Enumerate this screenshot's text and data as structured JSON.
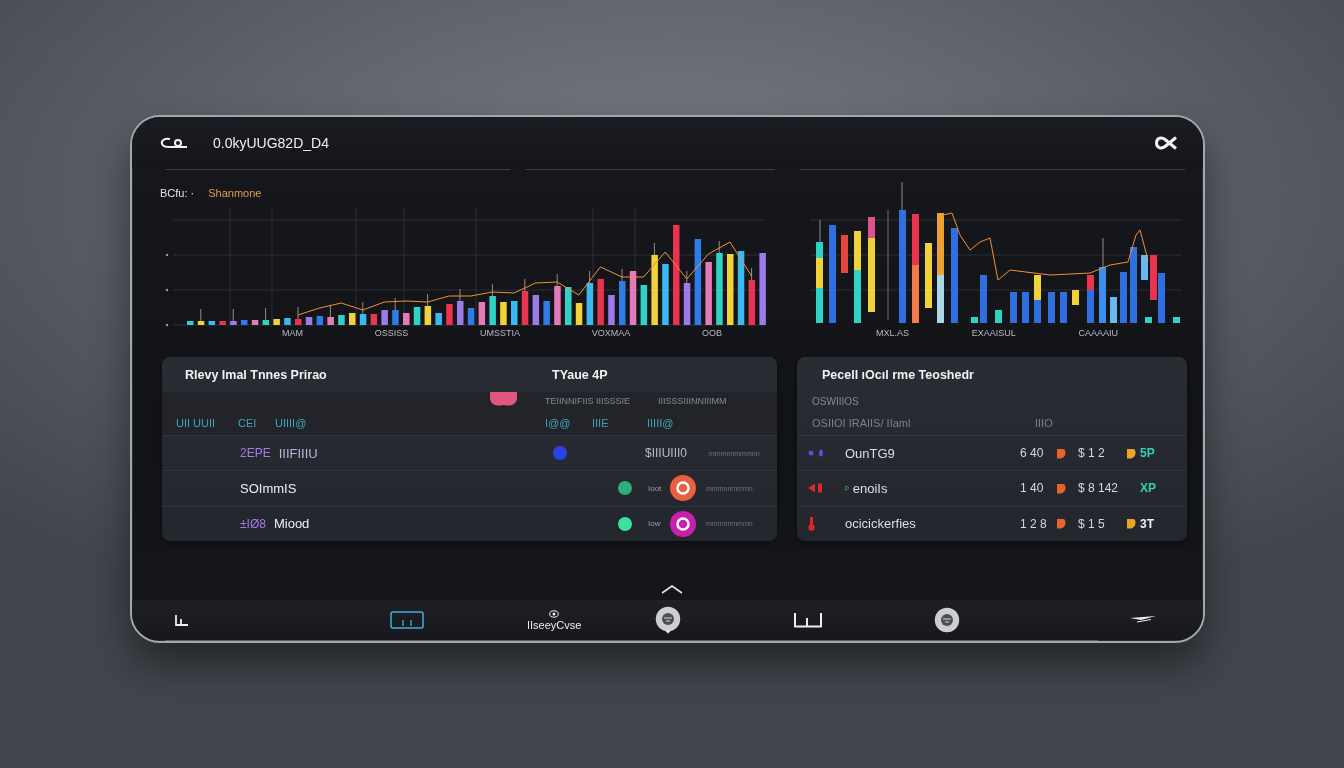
{
  "header": {
    "title": "0.0kyUUG82D_D4"
  },
  "left_chart": {
    "label": "BCfu: ·",
    "sublabel": "Shanmone",
    "x_labels": [
      "MAM",
      "OSSISS",
      "UMSSTIA",
      "VOXMAA",
      "OOB"
    ]
  },
  "right_chart": {
    "x_labels": [
      "MXL.AS",
      "EXAAISUL",
      "CAAAAIU"
    ]
  },
  "left_panel": {
    "title": "Rlevy Imal Tnnes Prirao",
    "title_2": "TYaue 4P",
    "subheaders": [
      "TEIINNIFIIS IIISSSIE",
      "IIISSSIIINNIIIMM"
    ],
    "columns": [
      "UII UUII",
      "CEI",
      "UIIII@",
      "I@@",
      "IIIE",
      "IIIII@"
    ],
    "rows": [
      {
        "kind": "value",
        "tag": "2EPE",
        "name": "IIIFIIIU",
        "color": "#2a40e8",
        "value": "$IIIUIII0",
        "note": "mmmnnmmmnn"
      },
      {
        "kind": "badge",
        "name": "SOImmIS",
        "color": "#2fb07a",
        "caption": "Ioot",
        "badge": {
          "color": "#e8603f"
        },
        "note": "mmmnnmmmn"
      },
      {
        "kind": "badge",
        "tag": "±IØ8",
        "name": "Miood",
        "color": "#3ee0a0",
        "caption": "Iow",
        "badge": {
          "color": "#c81fae"
        },
        "note": "mmmnnmmmn"
      }
    ]
  },
  "right_panel": {
    "title": "Pecell ıOcıl rme Teoshedr",
    "subtitle": "OSWIIIOS",
    "columns": [
      "OSIIOI IRAIIS/ IIaml",
      "IIIO"
    ],
    "rows": [
      {
        "color": "#5b50d0",
        "name": "OunTG9",
        "qty": "6 40",
        "price": "$ 1 2",
        "price_icon": true,
        "suffix": "5P",
        "accent": true
      },
      {
        "color": "#d8282e",
        "prefix": "ᵖ",
        "name": "enoiIs",
        "qty": "1 40",
        "price": "$ 8 142",
        "price_icon": false,
        "suffix": "XP",
        "accent": true
      },
      {
        "color": "#d8282e",
        "name": "ocicickerfies",
        "qty": "1 2 8",
        "price": "$ 1 5",
        "price_icon": true,
        "suffix": "3T",
        "accent": false
      }
    ]
  },
  "nav": {
    "items": [
      {
        "selected": false
      },
      {
        "selected": true
      },
      {
        "label": "IIseeyCvse",
        "selected": false
      },
      {
        "selected": false
      },
      {
        "selected": false
      },
      {
        "selected": false
      },
      {
        "selected": false
      }
    ]
  }
}
